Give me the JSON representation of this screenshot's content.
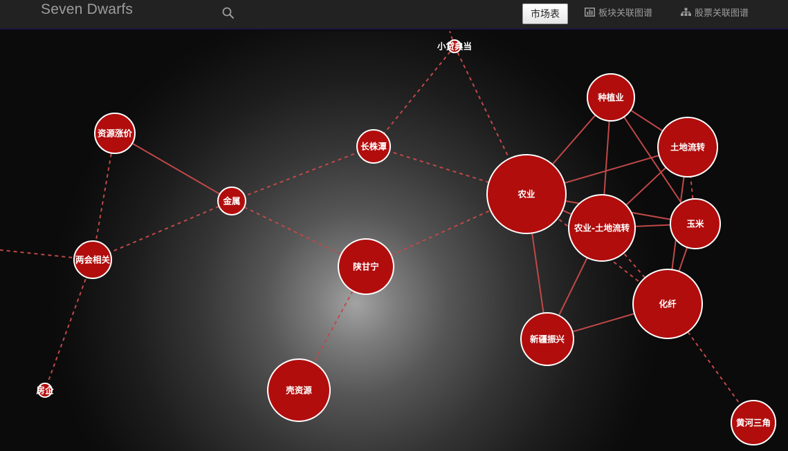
{
  "navbar": {
    "brand": "Seven Dwarfs",
    "search_icon": "search-icon",
    "market_button": "市场表",
    "sector_graph_link": "板块关联图谱",
    "sector_graph_icon": "bar-chart-icon",
    "stock_graph_link": "股票关联图谱",
    "stock_graph_icon": "sitemap-icon"
  },
  "graph": {
    "node_color": "#b10d0d",
    "edge_color": "#c24848",
    "nodes": [
      {
        "id": "xiaodaidang",
        "label": "小贷典当"
      },
      {
        "id": "ziyuanzhangjia",
        "label": "资源涨价"
      },
      {
        "id": "changzhutan",
        "label": "长株潭"
      },
      {
        "id": "jinshu",
        "label": "金属"
      },
      {
        "id": "lianghui",
        "label": "两会相关"
      },
      {
        "id": "shanganning",
        "label": "陕甘宁"
      },
      {
        "id": "fangqi",
        "label": "房企"
      },
      {
        "id": "keziyuan",
        "label": "壳资源"
      },
      {
        "id": "nongye",
        "label": "农业"
      },
      {
        "id": "zhongzhiye",
        "label": "种植业"
      },
      {
        "id": "tudiliuzhuan",
        "label": "土地流转"
      },
      {
        "id": "nongye_tudi",
        "label": "农业-土地流转"
      },
      {
        "id": "yumi",
        "label": "玉米"
      },
      {
        "id": "huaxian",
        "label": "化纤"
      },
      {
        "id": "xinjiang",
        "label": "新疆振兴"
      },
      {
        "id": "huanghe",
        "label": "黄河三角"
      }
    ]
  }
}
